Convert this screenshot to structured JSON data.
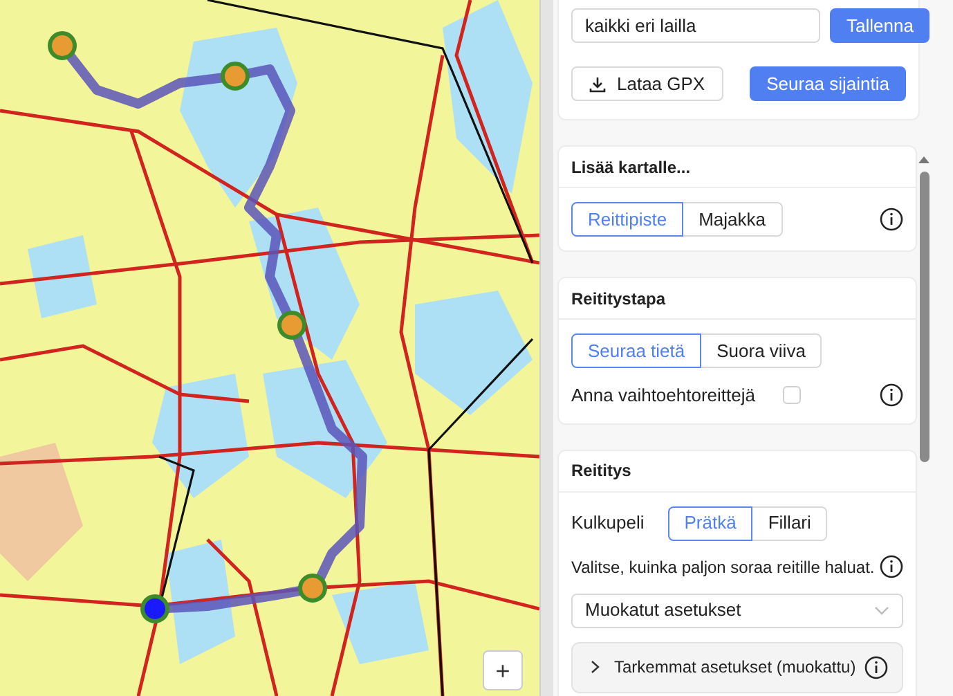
{
  "map": {
    "zoom_button": "+"
  },
  "top_card": {
    "name_input": {
      "value": "kaikki eri lailla"
    },
    "save_button": "Tallenna",
    "download_button": "Lataa GPX",
    "follow_button": "Seuraa sijaintia"
  },
  "sections": [
    {
      "title": "Lisää kartalle...",
      "rows": [
        {
          "kind": "segmented",
          "info": true,
          "options": [
            {
              "label": "Reittipiste",
              "selected": true
            },
            {
              "label": "Majakka",
              "selected": false
            }
          ]
        }
      ]
    },
    {
      "title": "Reititystapa",
      "rows": [
        {
          "kind": "segmented",
          "options": [
            {
              "label": "Seuraa tietä",
              "selected": true
            },
            {
              "label": "Suora viiva",
              "selected": false
            }
          ]
        },
        {
          "kind": "checkbox",
          "label": "Anna vaihtoehtoreittejä",
          "checked": false,
          "info": true
        }
      ]
    },
    {
      "title": "Reititys",
      "rows": [
        {
          "kind": "segmented",
          "label": "Kulkupeli",
          "options": [
            {
              "label": "Prätkä",
              "selected": true
            },
            {
              "label": "Fillari",
              "selected": false
            }
          ]
        },
        {
          "kind": "text",
          "text": "Valitse, kuinka paljon soraa reitille haluat.",
          "info": true
        },
        {
          "kind": "select",
          "value": "Muokatut asetukset"
        },
        {
          "kind": "collapsible",
          "label": "Tarkemmat asetukset (muokattu)",
          "expanded": false,
          "info": true
        }
      ]
    }
  ]
}
